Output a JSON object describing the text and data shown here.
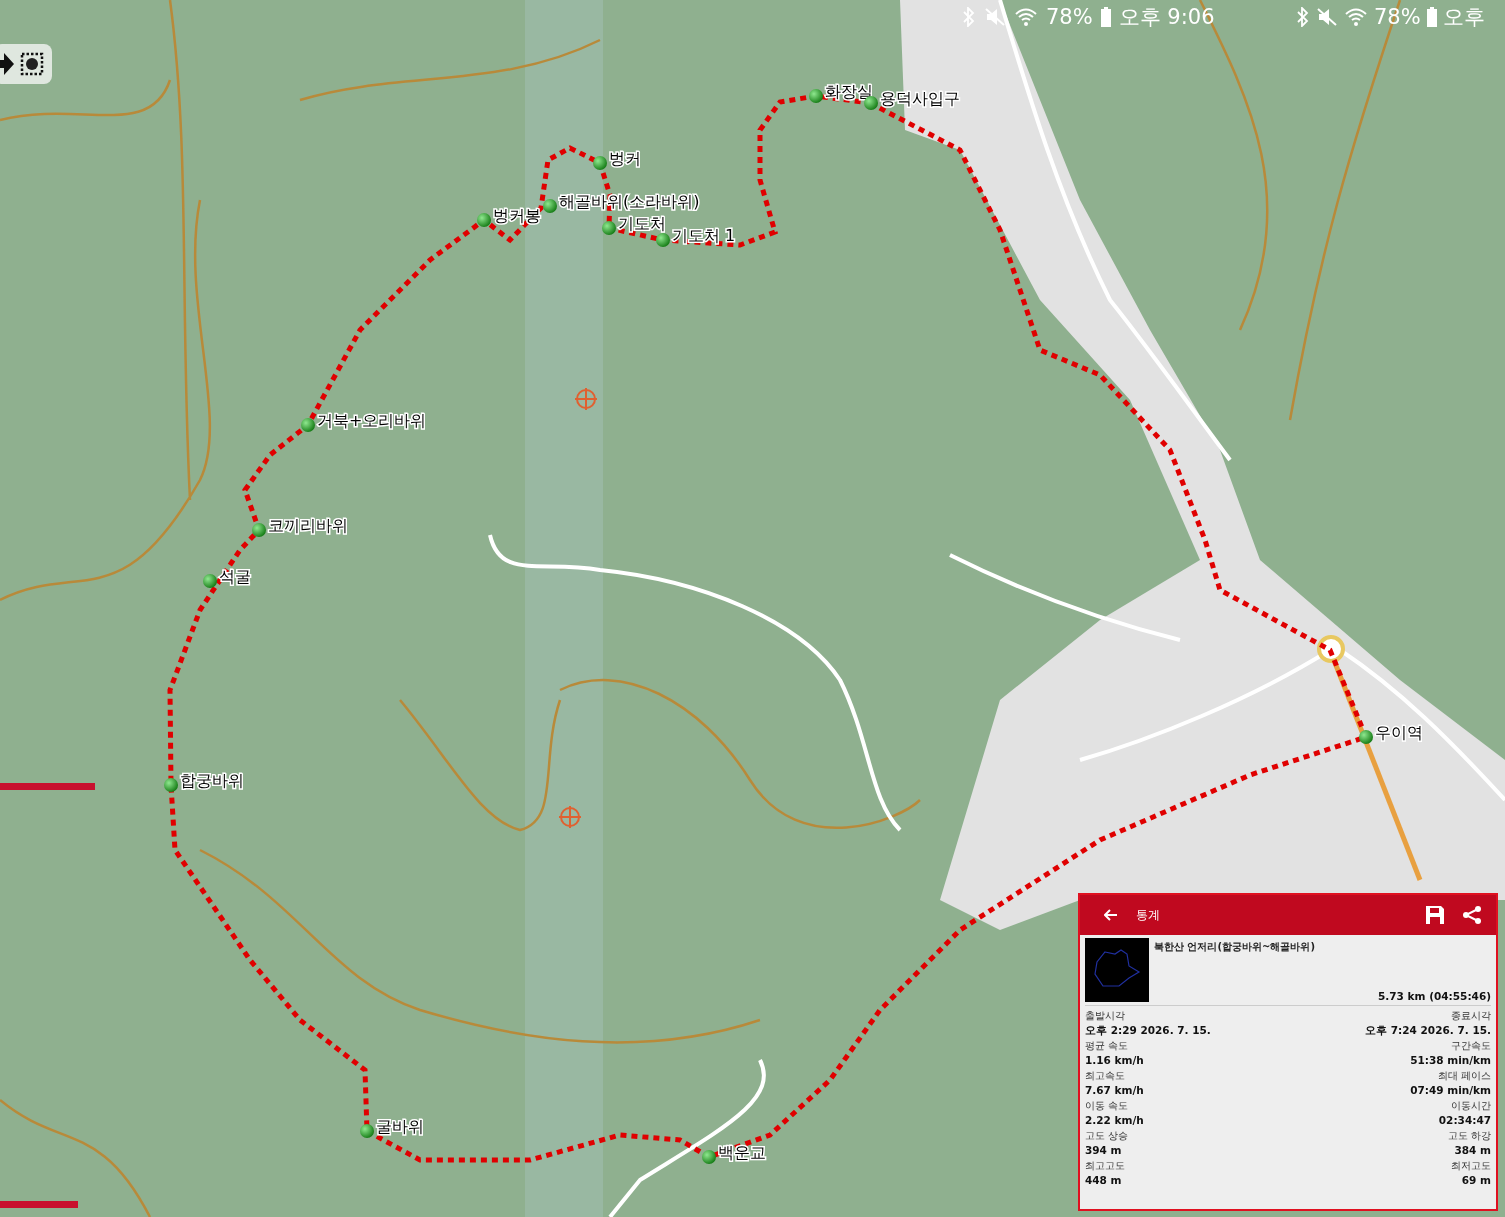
{
  "status_bars": [
    {
      "battery": "78%",
      "time": "오후 9:06"
    },
    {
      "battery": "78%",
      "time": "오후"
    }
  ],
  "map": {
    "waypoints": [
      {
        "name": "화장실"
      },
      {
        "name": "용덕사입구"
      },
      {
        "name": "벙커"
      },
      {
        "name": "해골바위(소라바위)"
      },
      {
        "name": "벙커봉"
      },
      {
        "name": "기도처"
      },
      {
        "name": "기도처 1"
      },
      {
        "name": "거북+오리바위"
      },
      {
        "name": "코끼리바위"
      },
      {
        "name": "석굴"
      },
      {
        "name": "합궁바위"
      },
      {
        "name": "굴바위"
      },
      {
        "name": "백운교"
      },
      {
        "name": "우이역"
      }
    ]
  },
  "stats_panel": {
    "title": "통계",
    "track_name": "북한산 언저리(합궁바위~해골바위)",
    "distance": "5.73 km (04:55:46)",
    "stats": [
      {
        "label": "출발시각",
        "value": "오후 2:29 2026. 7. 15."
      },
      {
        "label": "종료시각",
        "value": "오후 7:24 2026. 7. 15."
      },
      {
        "label": "평균 속도",
        "value": "1.16 km/h"
      },
      {
        "label": "구간속도",
        "value": "51:38 min/km"
      },
      {
        "label": "최고속도",
        "value": "7.67 km/h"
      },
      {
        "label": "최대 페이스",
        "value": "07:49 min/km"
      },
      {
        "label": "이동 속도",
        "value": "2.22 km/h"
      },
      {
        "label": "이동시간",
        "value": "02:34:47"
      },
      {
        "label": "고도 상승",
        "value": "394 m"
      },
      {
        "label": "고도 하강",
        "value": "384 m"
      },
      {
        "label": "최고고도",
        "value": "448 m"
      },
      {
        "label": "최저고도",
        "value": "69 m"
      }
    ]
  }
}
